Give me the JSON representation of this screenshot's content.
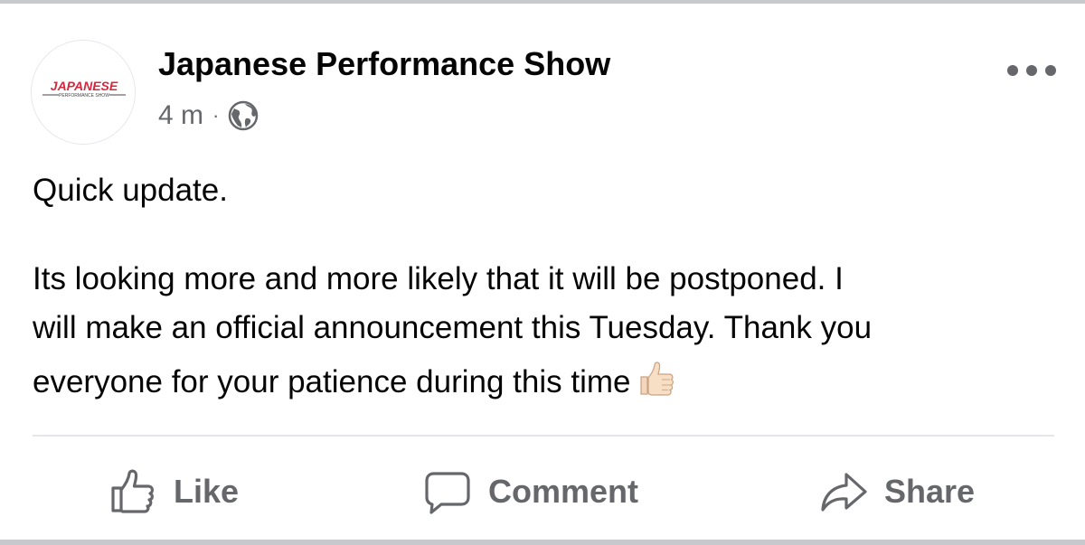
{
  "post": {
    "page_name": "Japanese Performance Show",
    "timestamp": "4 m",
    "separator": "·",
    "privacy_icon": "globe-icon",
    "more_icon": "more-horizontal-icon",
    "avatar": {
      "logo_text": "JAPANESE",
      "logo_subtext": "PERFORMANCE SHOW",
      "logo_color": "#d7263d"
    },
    "text": {
      "line1": "Quick update.",
      "paragraph2_line1": "Its looking more and more likely that it will be postponed. I",
      "paragraph2_line2": "will make an official announcement this Tuesday. Thank you",
      "paragraph2_line3": "everyone for your patience during this time",
      "emoji": "thumbs-up-light-skin-tone"
    }
  },
  "actions": {
    "like_label": "Like",
    "like_icon": "thumbs-up-icon",
    "comment_label": "Comment",
    "comment_icon": "speech-bubble-icon",
    "share_label": "Share",
    "share_icon": "share-arrow-icon"
  },
  "colors": {
    "text_primary": "#050505",
    "text_secondary": "#65676b",
    "divider": "#e4e6eb",
    "background": "#ffffff"
  }
}
